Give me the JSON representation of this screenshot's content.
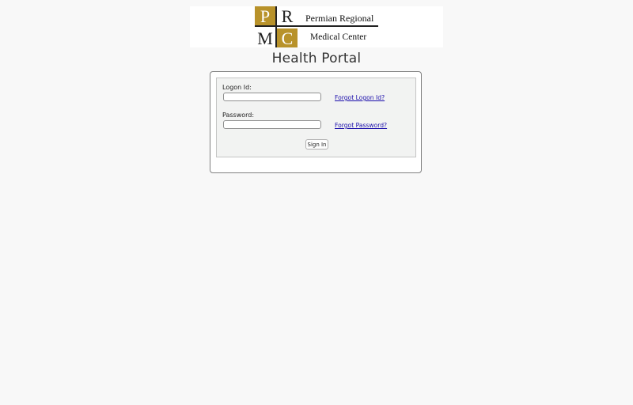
{
  "logo": {
    "letters": [
      "P",
      "R",
      "M",
      "C"
    ],
    "line1": "Permian Regional",
    "line2": "Medical Center",
    "gold_color": "#b8922a"
  },
  "portal": {
    "title": "Health Portal"
  },
  "login": {
    "logon_label": "Logon Id:",
    "logon_value": "",
    "forgot_logon": "Forgot Logon Id?",
    "password_label": "Password:",
    "password_value": "",
    "forgot_password": "Forgot Password?",
    "signin_label": "Sign In"
  },
  "colors": {
    "link": "#1a0dab",
    "page_bg": "#f8f8f8"
  }
}
